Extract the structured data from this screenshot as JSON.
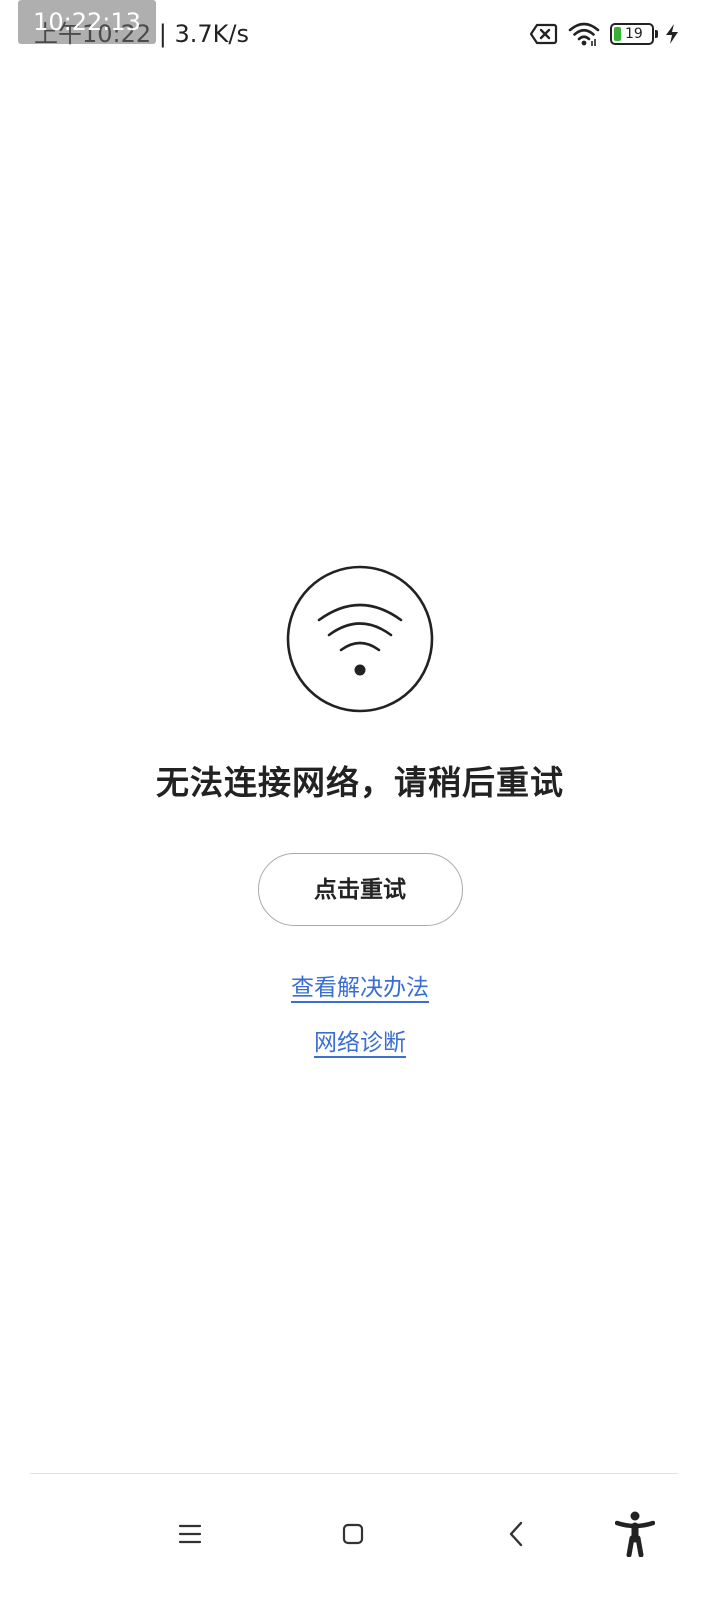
{
  "status_bar": {
    "time_text": "上午10:22 | 3.7K/s",
    "recording_time": "10:22:13",
    "battery_level": "19",
    "battery_fraction": 0.19,
    "icons": [
      "sim-disabled-icon",
      "wifi-icon",
      "battery-icon",
      "charging-icon"
    ]
  },
  "error": {
    "icon": "wifi-icon",
    "title": "无法连接网络，请稍后重试",
    "retry_label": "点击重试",
    "solutions_link": "查看解决办法",
    "diagnose_link": "网络诊断"
  },
  "nav_bar": {
    "buttons": [
      "menu-icon",
      "home-icon",
      "back-icon",
      "accessibility-icon"
    ]
  },
  "colors": {
    "link": "#3a6fd1",
    "text": "#222222",
    "battery": "#34b233",
    "button_border": "#a9a9a9"
  }
}
